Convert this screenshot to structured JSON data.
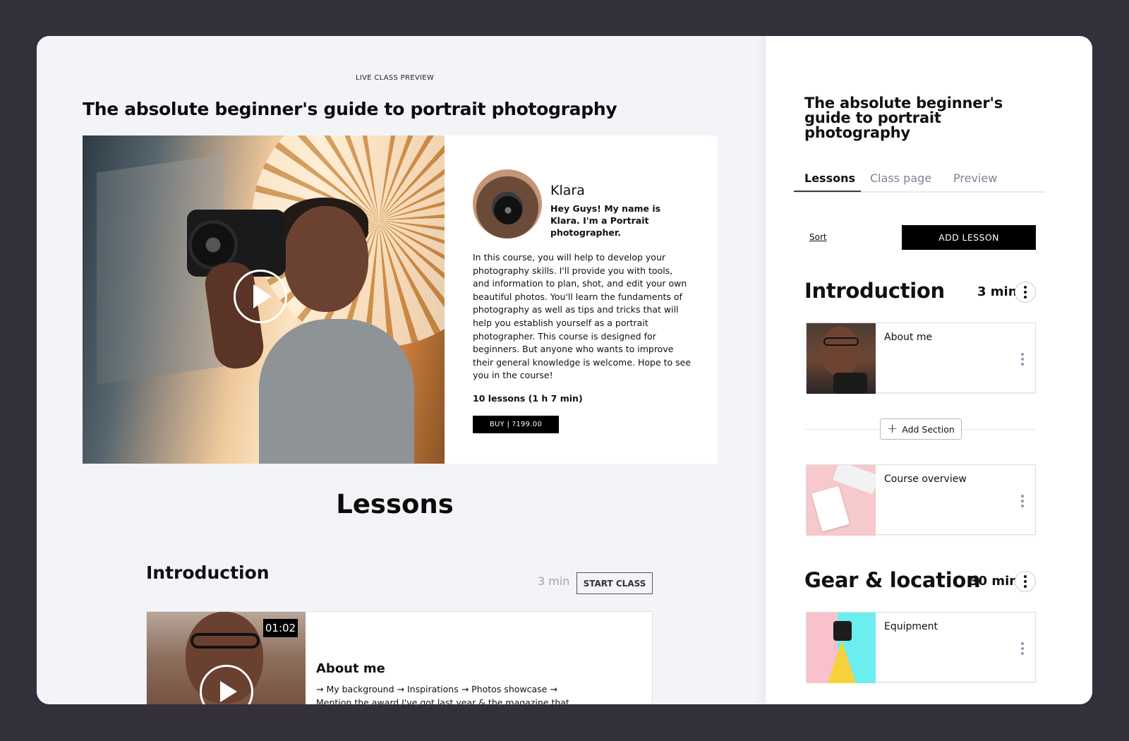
{
  "preview": {
    "live_label": "LIVE CLASS PREVIEW",
    "course_title": "The absolute beginner's guide to portrait photography",
    "instructor_name": "Klara",
    "instructor_bio": "Hey Guys! My name is Klara. I'm a Portrait photographer.",
    "description": "In this course, you will help to develop your photography skills. I'll provide you with tools, and information to plan, shot, and edit your own beautiful photos. You'll learn the fundaments of photography as well as tips and tricks that will help you establish yourself as a portrait photographer. This course is designed for beginners. But anyone who wants to improve their general knowledge is welcome. Hope to see you in the course!",
    "lesson_count": "10 lessons (1 h 7 min)",
    "buy_label": "BUY | ?199.00",
    "lessons_heading": "Lessons",
    "section": {
      "title": "Introduction",
      "duration": "3 min",
      "start_label": "START CLASS"
    },
    "lesson": {
      "duration_badge": "01:02",
      "title": "About me",
      "description": "→ My background → Inspirations → Photos showcase → Mention the award I've got last year & the magazine that"
    }
  },
  "editor": {
    "title": "The absolute beginner's guide to portrait photography",
    "tabs": [
      {
        "label": "Lessons"
      },
      {
        "label": "Class page"
      },
      {
        "label": "Preview"
      }
    ],
    "sort_label": "Sort",
    "add_lesson_label": "ADD LESSON",
    "add_section_label": "Add Section",
    "sections": [
      {
        "title": "Introduction",
        "duration": "3 min",
        "lessons": [
          {
            "title": "About me"
          }
        ]
      },
      {
        "lessons": [
          {
            "title": "Course overview"
          }
        ]
      },
      {
        "title": "Gear & location",
        "duration": "30 min",
        "lessons": [
          {
            "title": "Equipment"
          }
        ]
      }
    ]
  },
  "colors": {
    "app_background": "#33303b",
    "preview_background": "#f3f4f8",
    "button_primary": "#000000",
    "tab_muted": "#7f8392"
  }
}
